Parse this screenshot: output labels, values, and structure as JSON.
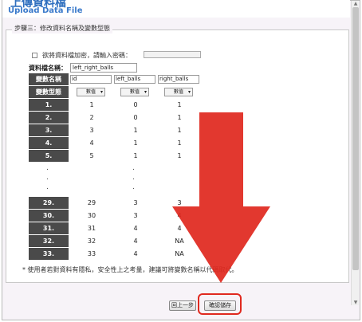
{
  "header": {
    "title": "上傳資料檔",
    "subtitle": "Upload Data File"
  },
  "panel": {
    "legend": "步驟三：修改資料名稱及變數型態"
  },
  "encrypt": {
    "label": "欲將資料檔加密，請輸入密碼：",
    "password_value": ""
  },
  "file": {
    "label": "資料檔名稱：",
    "value": "left_right_balls"
  },
  "grid": {
    "name_header": "變數名稱",
    "type_header": "變數型態",
    "columns": [
      {
        "name": "id",
        "type": "數值"
      },
      {
        "name": "left_balls",
        "type": "數值"
      },
      {
        "name": "right_balls",
        "type": "數值"
      }
    ],
    "top_rows": [
      {
        "label": "1.",
        "cells": [
          "1",
          "0",
          "1"
        ]
      },
      {
        "label": "2.",
        "cells": [
          "2",
          "0",
          "1"
        ]
      },
      {
        "label": "3.",
        "cells": [
          "3",
          "1",
          "1"
        ]
      },
      {
        "label": "4.",
        "cells": [
          "4",
          "1",
          "1"
        ]
      },
      {
        "label": "5.",
        "cells": [
          "5",
          "1",
          "1"
        ]
      }
    ],
    "ellipsis": ".",
    "bottom_rows": [
      {
        "label": "29.",
        "cells": [
          "29",
          "3",
          "3"
        ]
      },
      {
        "label": "30.",
        "cells": [
          "30",
          "3",
          "4"
        ]
      },
      {
        "label": "31.",
        "cells": [
          "31",
          "4",
          "4"
        ]
      },
      {
        "label": "32.",
        "cells": [
          "32",
          "4",
          "NA"
        ]
      },
      {
        "label": "33.",
        "cells": [
          "33",
          "4",
          "NA"
        ]
      }
    ]
  },
  "footnote": "* 使用者若對資料有隱私，安全性上之考量，建議可將變數名稱以代碼取代。",
  "buttons": {
    "back": "回上一步",
    "confirm": "確認儲存"
  },
  "colors": {
    "header_title": "#2f6fbf",
    "row_header_bg": "#4a4a4a",
    "highlight": "#e0291f",
    "arrow": "#e0291f"
  },
  "icons": {
    "dropdown": "chevron-down-icon",
    "annotation": "arrow-down-icon"
  }
}
